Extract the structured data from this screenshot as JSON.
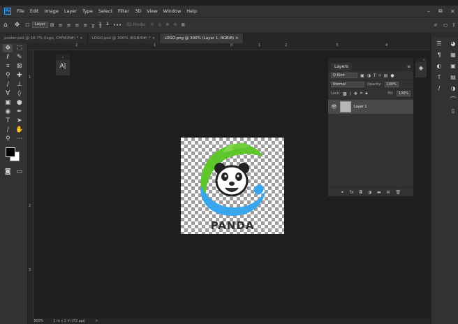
{
  "app": {
    "logo": "Ps"
  },
  "menu": [
    "File",
    "Edit",
    "Image",
    "Layer",
    "Type",
    "Select",
    "Filter",
    "3D",
    "View",
    "Window",
    "Help"
  ],
  "window_controls": {
    "minimize": "–",
    "restore": "⧉",
    "close": "✕"
  },
  "options_bar": {
    "layer_select": "Layer",
    "mode_label": "3D Mode:"
  },
  "tabs": [
    {
      "label": "poster.psd @ 16.7% (logo, CMYK/8#) *"
    },
    {
      "label": "LOGO.psd @ 300% (RGB/8#) *"
    },
    {
      "label": "LOGO.png @ 300% (Layer 1, RGB/8)"
    }
  ],
  "ruler": {
    "top": [
      "2",
      "1",
      "0",
      "1",
      "2",
      "3",
      "4"
    ],
    "left": [
      "1",
      "2",
      "3"
    ]
  },
  "layers_panel": {
    "tab": "Layers",
    "kind_filter": "Q Kind",
    "blend_mode": "Normal",
    "opacity_label": "Opacity:",
    "opacity_value": "100%",
    "lock_label": "Lock:",
    "fill_label": "Fill:",
    "fill_value": "100%",
    "layers": [
      {
        "name": "Layer 1"
      }
    ]
  },
  "status": {
    "zoom": "300%",
    "size": "1 in x 1 in (72 ppi)",
    "arrow": ">"
  },
  "document": {
    "word": "PANDA"
  },
  "colors": {
    "accent": "#31a8ff",
    "green": "#5dc62a",
    "blue": "#3aa6ee",
    "dark": "#222222"
  }
}
